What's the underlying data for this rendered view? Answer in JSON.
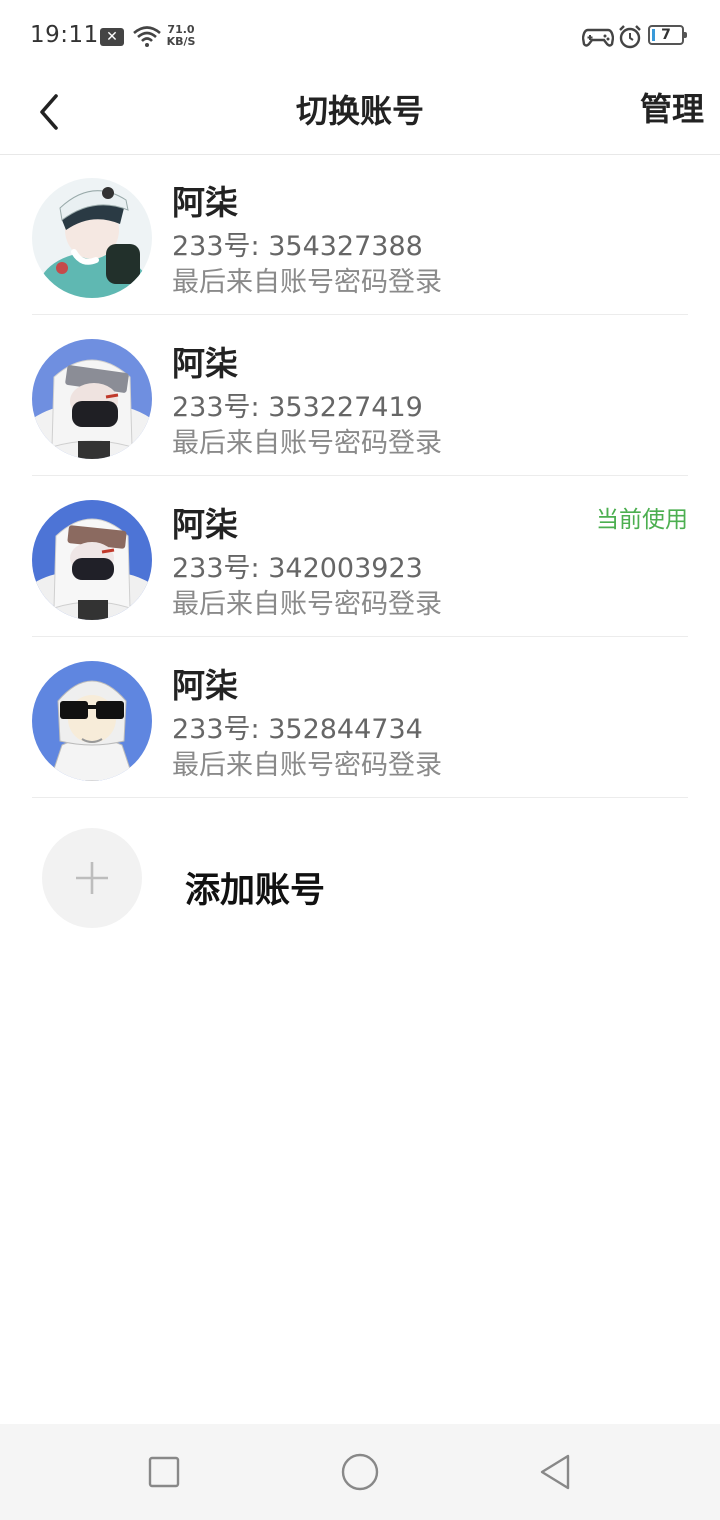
{
  "status_bar": {
    "time": "19:11",
    "notification_icon": "close-box-icon",
    "speed_value": "71.0",
    "speed_unit": "KB/S",
    "battery_level": "7"
  },
  "header": {
    "title": "切换账号",
    "manage_label": "管理",
    "back_icon": "chevron-left-icon"
  },
  "accounts": [
    {
      "name": "阿柒",
      "id_text": "233号: 354327388",
      "login_text": "最后来自账号密码登录",
      "current_label": ""
    },
    {
      "name": "阿柒",
      "id_text": "233号: 353227419",
      "login_text": "最后来自账号密码登录",
      "current_label": ""
    },
    {
      "name": "阿柒",
      "id_text": "233号: 342003923",
      "login_text": "最后来自账号密码登录",
      "current_label": "当前使用"
    },
    {
      "name": "阿柒",
      "id_text": "233号: 352844734",
      "login_text": "最后来自账号密码登录",
      "current_label": ""
    }
  ],
  "add_account": {
    "label": "添加账号",
    "icon": "plus-icon"
  },
  "nav_bar": {
    "recent_icon": "square-icon",
    "home_icon": "circle-icon",
    "back_icon": "triangle-back-icon"
  },
  "colors": {
    "current_badge": "#4caf50",
    "nav_background": "#f5f5f5",
    "divider": "#ececec"
  }
}
